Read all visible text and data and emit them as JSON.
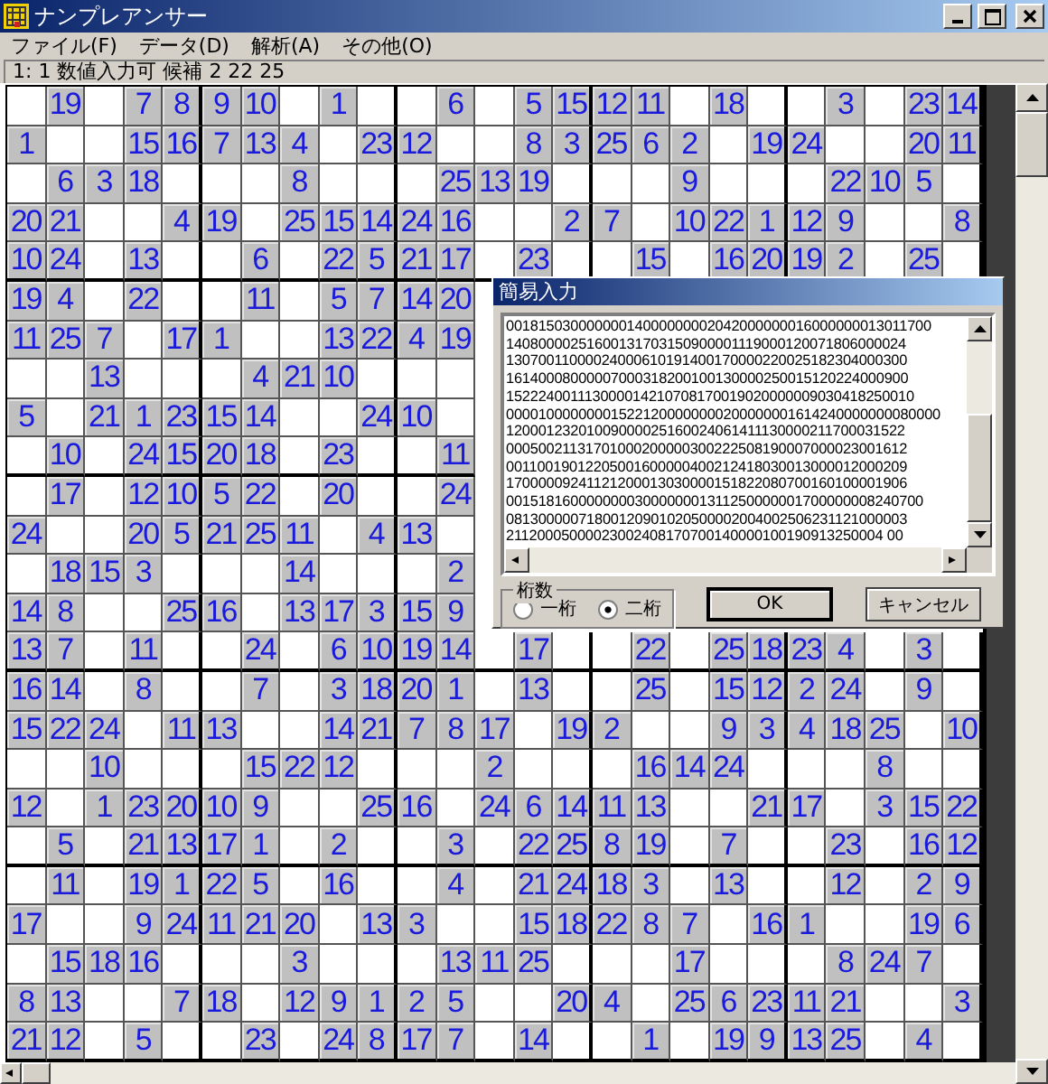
{
  "window": {
    "title": "ナンプレアンサー"
  },
  "menu": [
    {
      "label": "ファイル(F)"
    },
    {
      "label": "データ(D)"
    },
    {
      "label": "解析(A)"
    },
    {
      "label": "その他(O)"
    }
  ],
  "status_bar": "1: 1  数値入力可  候補 2 22 25",
  "grid": {
    "rows": [
      [
        null,
        "19",
        null,
        "7",
        "8",
        "9",
        "10",
        null,
        "1",
        null,
        null,
        "6",
        null,
        "5",
        "15",
        "12",
        "11",
        null,
        "18",
        null,
        null,
        "3",
        null,
        "23",
        "14"
      ],
      [
        "1",
        null,
        null,
        "15",
        "16",
        "7",
        "13",
        "4",
        null,
        "23",
        "12",
        null,
        null,
        "8",
        "3",
        "25",
        "6",
        "2",
        null,
        "19",
        "24",
        null,
        null,
        "20",
        "11"
      ],
      [
        null,
        "6",
        "3",
        "18",
        null,
        null,
        null,
        "8",
        null,
        null,
        null,
        "25",
        "13",
        "19",
        null,
        null,
        null,
        "9",
        null,
        null,
        null,
        "22",
        "10",
        "5",
        null
      ],
      [
        "20",
        "21",
        null,
        null,
        "4",
        "19",
        null,
        "25",
        "15",
        "14",
        "24",
        "16",
        null,
        null,
        "2",
        "7",
        null,
        "10",
        "22",
        "1",
        "12",
        "9",
        null,
        null,
        "8"
      ],
      [
        "10",
        "24",
        null,
        "13",
        null,
        null,
        "6",
        null,
        "22",
        "5",
        "21",
        "17",
        null,
        "23",
        null,
        null,
        "15",
        null,
        "16",
        "20",
        "19",
        "2",
        null,
        "25",
        null
      ],
      [
        "19",
        "4",
        null,
        "22",
        null,
        null,
        "11",
        null,
        "5",
        "7",
        "14",
        "20"
      ],
      [
        "11",
        "25",
        "7",
        null,
        "17",
        "1",
        null,
        null,
        "13",
        "22",
        "4",
        "19"
      ],
      [
        null,
        null,
        "13",
        null,
        null,
        null,
        "4",
        "21",
        "10",
        null,
        null,
        null
      ],
      [
        "5",
        null,
        "21",
        "1",
        "23",
        "15",
        "14",
        null,
        null,
        "24",
        "10",
        null
      ],
      [
        null,
        "10",
        null,
        "24",
        "15",
        "20",
        "18",
        null,
        "23",
        null,
        null,
        "11"
      ],
      [
        null,
        "17",
        null,
        "12",
        "10",
        "5",
        "22",
        null,
        "20",
        null,
        null,
        "24"
      ],
      [
        "24",
        null,
        null,
        "20",
        "5",
        "21",
        "25",
        "11",
        null,
        "4",
        "13",
        null
      ],
      [
        null,
        "18",
        "15",
        "3",
        null,
        null,
        null,
        "14",
        null,
        null,
        null,
        "2"
      ],
      [
        "14",
        "8",
        null,
        null,
        "25",
        "16",
        null,
        "13",
        "17",
        "3",
        "15",
        "9"
      ],
      [
        "13",
        "7",
        null,
        "11",
        null,
        null,
        "24",
        null,
        "6",
        "10",
        "19",
        "14",
        null,
        "17",
        null,
        null,
        "22",
        null,
        "25",
        "18",
        "23",
        "4",
        null,
        "3",
        null
      ],
      [
        "16",
        "14",
        null,
        "8",
        null,
        null,
        "7",
        null,
        "3",
        "18",
        "20",
        "1",
        null,
        "13",
        null,
        null,
        "25",
        null,
        "15",
        "12",
        "2",
        "24",
        null,
        "9",
        null
      ],
      [
        "15",
        "22",
        "24",
        null,
        "11",
        "13",
        null,
        null,
        "14",
        "21",
        "7",
        "8",
        "17",
        null,
        "19",
        "2",
        null,
        null,
        "9",
        "3",
        "4",
        "18",
        "25",
        null,
        "10"
      ],
      [
        null,
        null,
        "10",
        null,
        null,
        null,
        "15",
        "22",
        "12",
        null,
        null,
        null,
        "2",
        null,
        null,
        null,
        "16",
        "14",
        "24",
        null,
        null,
        null,
        "8",
        null,
        null
      ],
      [
        "12",
        null,
        "1",
        "23",
        "20",
        "10",
        "9",
        null,
        null,
        "25",
        "16",
        null,
        "24",
        "6",
        "14",
        "11",
        "13",
        null,
        null,
        "21",
        "17",
        null,
        "3",
        "15",
        "22"
      ],
      [
        null,
        "5",
        null,
        "21",
        "13",
        "17",
        "1",
        null,
        "2",
        null,
        null,
        "3",
        null,
        "22",
        "25",
        "8",
        "19",
        null,
        "7",
        null,
        null,
        "23",
        null,
        "16",
        "12"
      ],
      [
        null,
        "11",
        null,
        "19",
        "1",
        "22",
        "5",
        null,
        "16",
        null,
        null,
        "4",
        null,
        "21",
        "24",
        "18",
        "3",
        null,
        "13",
        null,
        null,
        "12",
        null,
        "2",
        "9"
      ],
      [
        "17",
        null,
        null,
        "9",
        "24",
        "11",
        "21",
        "20",
        null,
        "13",
        "3",
        null,
        null,
        "15",
        "18",
        "22",
        "8",
        "7",
        null,
        "16",
        "1",
        null,
        null,
        "19",
        "6"
      ],
      [
        null,
        "15",
        "18",
        "16",
        null,
        null,
        null,
        "3",
        null,
        null,
        null,
        "13",
        "11",
        "25",
        null,
        null,
        null,
        "17",
        null,
        null,
        null,
        "8",
        "24",
        "7",
        null
      ],
      [
        "8",
        "13",
        null,
        null,
        "7",
        "18",
        null,
        "12",
        "9",
        "1",
        "2",
        "5",
        null,
        null,
        "20",
        "4",
        null,
        "25",
        "6",
        "23",
        "11",
        "21",
        null,
        null,
        "3"
      ],
      [
        "21",
        "12",
        null,
        "5",
        null,
        null,
        "23",
        null,
        "24",
        "8",
        "17",
        "7",
        null,
        "14",
        null,
        null,
        "1",
        null,
        "19",
        "9",
        "13",
        "25",
        null,
        "4",
        null
      ]
    ]
  },
  "dialog": {
    "title": "簡易入力",
    "text_lines": [
      "00181503000000014000000002042000000016000000013011700",
      "14080000251600131703150900001119000120071806000024",
      "13070011000024000610191400170000220025182304000300",
      "16140008000007000318200100130000250015120224000900",
      "152224001113000014210708170019020000009030418250010",
      "000010000000015221200000000200000001614240000000080000",
      "12000123201009000025160024061411130000211700031522",
      "00050021131701000200000300222508190007000023001612",
      "00110019012205001600000400212418030013000012000209",
      "17000009241121200013030000151822080700160100001906",
      "0015181600000000300000001311250000001700000008240700",
      "08130000071800120901020500002004002506231121000003",
      "21120005000023002408170700140000100190913250004 00"
    ],
    "digits_group": {
      "label": "桁数",
      "options": [
        {
          "label": "一桁",
          "selected": false
        },
        {
          "label": "二桁",
          "selected": true
        }
      ]
    },
    "buttons": [
      {
        "label": "OK",
        "kind": "default"
      },
      {
        "label": "キャンセル",
        "kind": "normal"
      }
    ]
  }
}
